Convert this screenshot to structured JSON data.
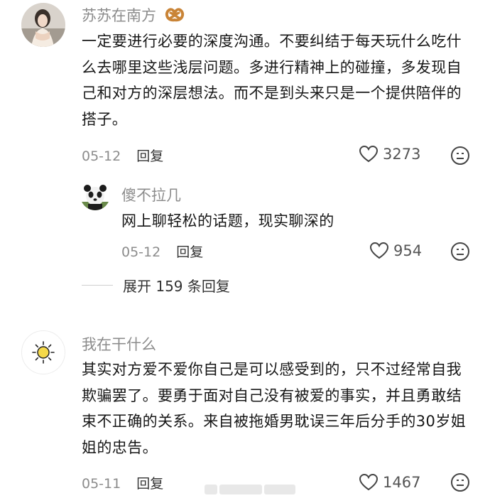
{
  "comments": [
    {
      "username": "苏苏在南方",
      "badge_icon": "pretzel-icon",
      "text": "一定要进行必要的深度沟通。不要纠结于每天玩什么吃什么去哪里这些浅层问题。多进行精神上的碰撞，多发现自己和对方的深层想法。而不是到头来只是一个提供陪伴的搭子。",
      "date": "05-12",
      "reply_label": "回复",
      "likes": "3273"
    },
    {
      "username": "傻不拉几",
      "text": "网上聊轻松的话题，现实聊深的",
      "date": "05-12",
      "reply_label": "回复",
      "likes": "954"
    },
    {
      "username": "我在干什么",
      "text": "其实对方爱不爱你自己是可以感受到的，只不过经常自我欺骗罢了。要勇于面对自己没有被爱的事实，并且勇敢结束不正确的关系。来自被拖婚男耽误三年后分手的30岁姐姐的忠告。",
      "date": "05-11",
      "reply_label": "回复",
      "likes": "1467"
    }
  ],
  "expand_replies": "展开 159 条回复",
  "colors": {
    "secondary_text": "#8c8c8c",
    "body_text": "#171717",
    "icon_stroke": "#333333"
  }
}
